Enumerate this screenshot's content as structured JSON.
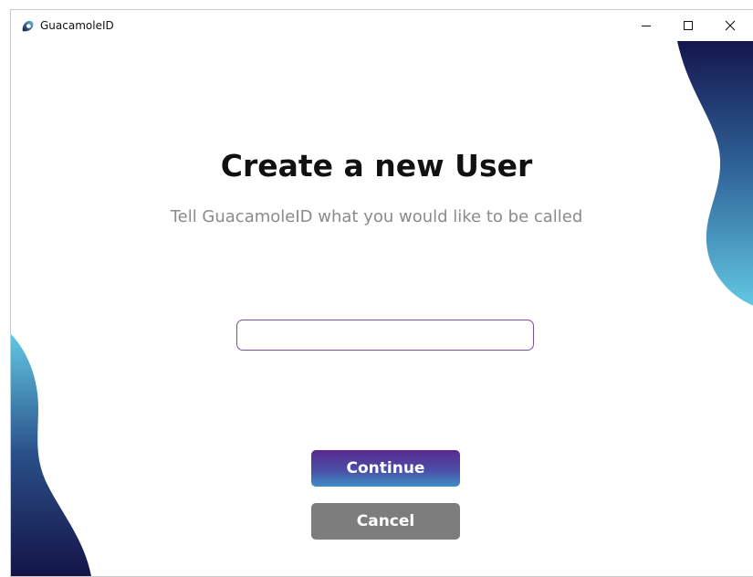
{
  "window": {
    "title": "GuacamoleID",
    "icon": "guacamole-logo-icon",
    "controls": [
      "minimize-icon",
      "maximize-icon",
      "close-icon"
    ]
  },
  "main": {
    "heading": "Create a new User",
    "subheading": "Tell GuacamoleID what you would like to be called",
    "name_input": {
      "value": "",
      "placeholder": ""
    },
    "continue_label": "Continue",
    "cancel_label": "Cancel"
  },
  "colors": {
    "accent_purple": "#5a2a91",
    "accent_cyan": "#5ec3e0",
    "dark_navy": "#15154a",
    "cancel_gray": "#7d7d7d",
    "input_border": "#7b4fa6"
  }
}
